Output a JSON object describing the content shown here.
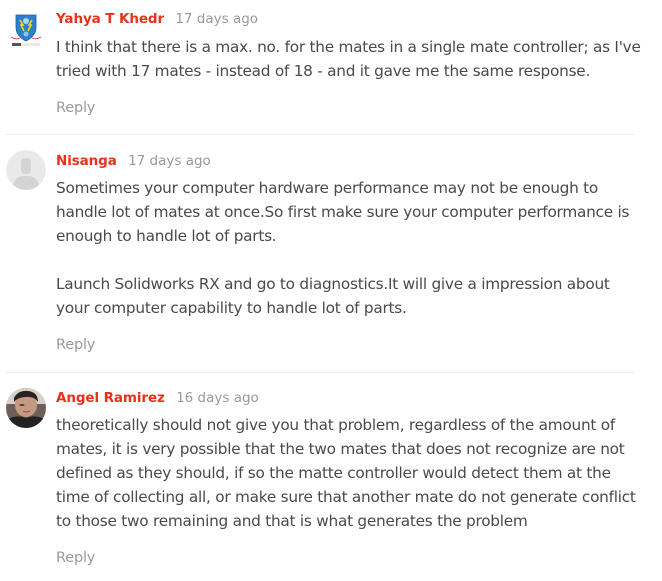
{
  "comments": [
    {
      "author": "Yahya T Khedr",
      "time": "17 days ago",
      "avatar_icon": "shield-logo-avatar",
      "paragraphs": [
        "I think that there is a max. no. for the mates in a single mate controller; as I've tried with 17 mates - instead of 18 - and it gave me the same response."
      ],
      "reply_label": "Reply"
    },
    {
      "author": "Nisanga",
      "time": "17 days ago",
      "avatar_icon": "default-user-avatar",
      "paragraphs": [
        "Sometimes your computer hardware performance may not be enough to handle lot of mates at once.So first make sure your computer performance is enough to handle lot of parts.",
        "Launch Solidworks RX and go to diagnostics.It will give a impression about your computer capability to handle lot of parts."
      ],
      "reply_label": "Reply"
    },
    {
      "author": "Angel Ramirez",
      "time": "16 days ago",
      "avatar_icon": "photo-avatar",
      "paragraphs": [
        "theoretically should not give you that problem, regardless of the amount of mates, it is very possible that the two mates that does not recognize are not defined as they should, if so the matte controller would detect them at the time of collecting all, or make sure that another mate do not generate conflict to those two remaining and that is what generates the problem"
      ],
      "reply_label": "Reply"
    }
  ],
  "colors": {
    "author": "#e8311b",
    "timestamp": "#999999",
    "body_text": "#4a4a4a",
    "reply": "#9a9a9a",
    "divider": "#ededed"
  }
}
